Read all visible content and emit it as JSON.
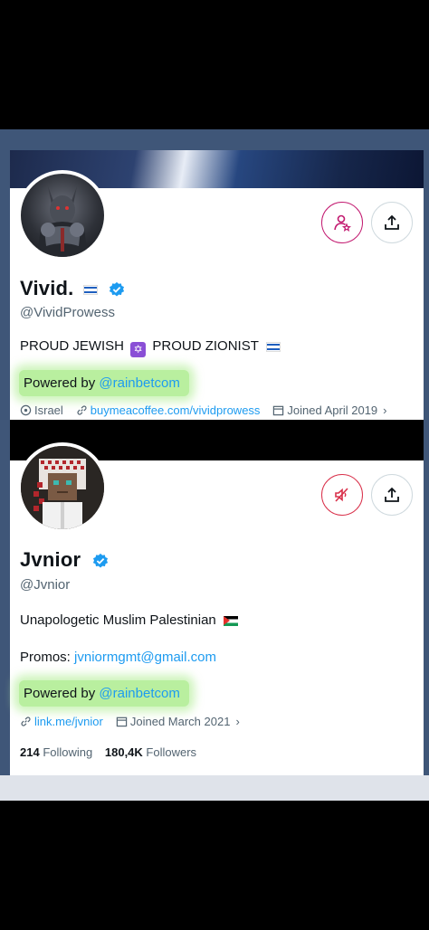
{
  "profiles": [
    {
      "name": "Vivid.",
      "handle": "@VividProwess",
      "bio_part1": "PROUD JEWISH",
      "bio_part2": "PROUD ZIONIST",
      "powered_prefix": "Powered by",
      "powered_link": "@rainbetcom",
      "location": "Israel",
      "website": "buymeacoffee.com/vividprowess",
      "joined": "Joined April 2019",
      "action_icon": "follow-person-icon",
      "share_icon": "share-icon"
    },
    {
      "name": "Jvnior",
      "handle": "@Jvnior",
      "bio": "Unapologetic Muslim Palestinian",
      "promos_prefix": "Promos:",
      "promos_email": "jvniormgmt@gmail.com",
      "powered_prefix": "Powered by",
      "powered_link": "@rainbetcom",
      "website": "link.me/jvnior",
      "joined": "Joined March 2021",
      "following_count": "214",
      "following_label": "Following",
      "followers_count": "180,4K",
      "followers_label": "Followers",
      "action_icon": "muted-icon",
      "share_icon": "share-icon"
    }
  ],
  "colors": {
    "accent_blue": "#1d9bf0",
    "highlight_green": "#b9ef9f",
    "follow_btn_pink": "#c2186f",
    "mute_btn_red": "#d9304a"
  }
}
